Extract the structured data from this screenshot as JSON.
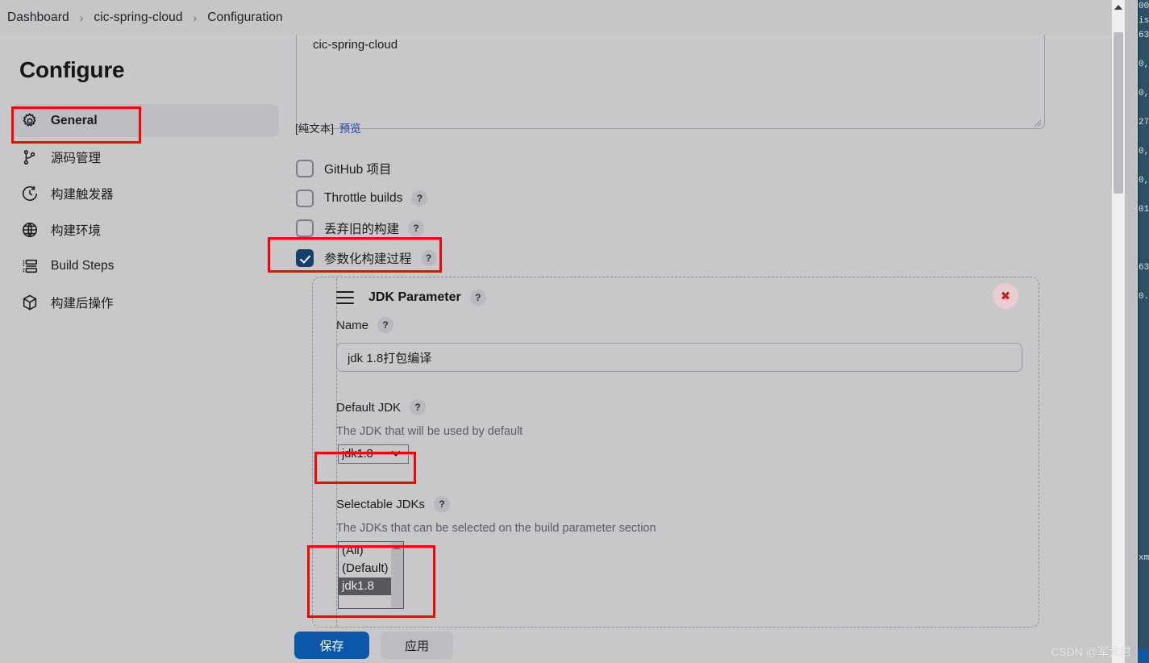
{
  "breadcrumb": {
    "items": [
      "Dashboard",
      "cic-spring-cloud",
      "Configuration"
    ],
    "separator": "›"
  },
  "sidebar": {
    "title": "Configure",
    "items": [
      {
        "label": "General",
        "icon": "gear-icon",
        "active": true
      },
      {
        "label": "源码管理",
        "icon": "source-control-icon",
        "active": false
      },
      {
        "label": "构建触发器",
        "icon": "clock-icon",
        "active": false
      },
      {
        "label": "构建环境",
        "icon": "globe-icon",
        "active": false
      },
      {
        "label": "Build Steps",
        "icon": "list-icon",
        "active": false
      },
      {
        "label": "构建后操作",
        "icon": "package-icon",
        "active": false
      }
    ]
  },
  "main": {
    "description": {
      "value": "cic-spring-cloud",
      "placeholder": "",
      "markup_note": "[纯文本]",
      "preview_link": "预览"
    },
    "checkboxes": [
      {
        "label": "GitHub 项目",
        "checked": false,
        "has_help": false
      },
      {
        "label": "Throttle builds",
        "checked": false,
        "has_help": true,
        "help": "?"
      },
      {
        "label": "丢弃旧的构建",
        "checked": false,
        "has_help": true,
        "help": "?"
      },
      {
        "label": "参数化构建过程",
        "checked": true,
        "has_help": true,
        "help": "?"
      }
    ],
    "parameter": {
      "title": "JDK Parameter",
      "help": "?",
      "close_label": "✖",
      "drag_handle": "hamburger-icon",
      "name_field": {
        "label": "Name",
        "help": "?",
        "value": "jdk 1.8打包编译"
      },
      "default_jdk": {
        "label": "Default JDK",
        "help": "?",
        "hint": "The JDK that will be used by default",
        "selected": "jdk1.8",
        "options": [
          "jdk1.8"
        ]
      },
      "selectable_jdks": {
        "label": "Selectable JDKs",
        "help": "?",
        "hint": "The JDKs that can be selected on the build parameter section",
        "options": [
          {
            "label": "(All)",
            "selected": false
          },
          {
            "label": "(Default)",
            "selected": false
          },
          {
            "label": "jdk1.8",
            "selected": true
          }
        ]
      }
    }
  },
  "footer": {
    "save_label": "保存",
    "apply_label": "应用"
  },
  "watermark": "CSDN @军大君",
  "colors": {
    "page_background": "#c8c8ca",
    "header_background": "#c6c6c9",
    "accent_primary": "#0d57a8",
    "checkbox_checked": "#13416c",
    "annotation_red": "#fb0303",
    "link_blue": "#1c44a8",
    "close_red": "#c0232f",
    "dark_panel": "#2b5166"
  },
  "dark_panel_fragments": [
    "00",
    "is",
    "63",
    "0,",
    "0,",
    "27",
    "0,",
    "0,",
    "01",
    "63",
    "0.",
    "xm"
  ]
}
